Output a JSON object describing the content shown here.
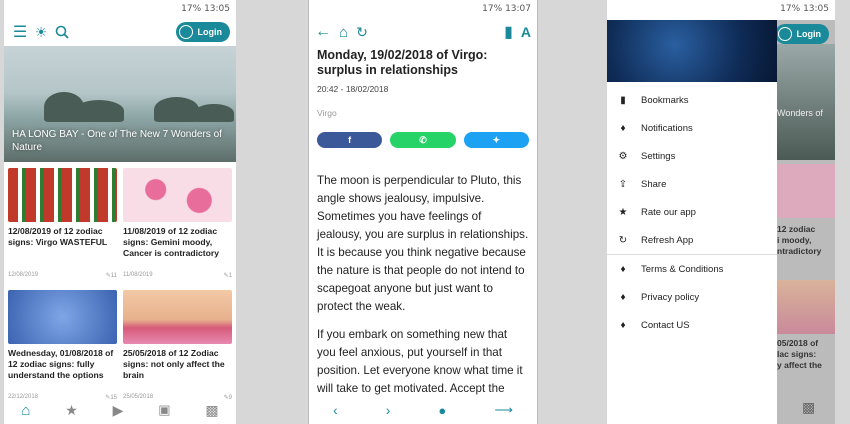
{
  "status": {
    "left_time": "13:05",
    "mid_time": "13:07",
    "right_time": "13:05",
    "battery": "17%"
  },
  "home": {
    "login": "Login",
    "hero_caption": "HA LONG BAY - One of The New 7 Wonders of Nature",
    "cards": [
      {
        "title": "12/08/2019 of 12 zodiac signs: Virgo WASTEFUL",
        "date": "12/08/2019",
        "count": "11",
        "color": "#c0392b"
      },
      {
        "title": "11/08/2019 of 12 zodiac signs: Gemini moody, Cancer is contradictory",
        "date": "11/08/2019",
        "count": "1",
        "color": "#f2b5c9"
      },
      {
        "title": "Wednesday, 01/08/2018 of 12 zodiac signs: fully understand the options",
        "date": "22/12/2018",
        "count": "15",
        "color": "#4f7fc9"
      },
      {
        "title": "25/05/2018 of 12 Zodiac signs: not only affect the brain",
        "date": "25/05/2018",
        "count": "9",
        "color": "#d9a27a"
      }
    ]
  },
  "article": {
    "title": "Monday, 19/02/2018 of Virgo: surplus in relationships",
    "time": "20:42 - 18/02/2018",
    "category": "Virgo",
    "para1": "The moon is perpendicular to Pluto, this angle shows jealousy, impulsive. Sometimes you have feelings of jealousy, you are surplus in relationships. It is because you think negative because the nature is that people do not intend to scapegoat anyone but just want to protect the weak.",
    "para2": "If you embark on something new that you feel anxious, put yourself in that position. Let everyone know what time it will take to get motivated. Accept the",
    "share_colors": {
      "facebook": "#3b5998",
      "whatsapp": "#25d366",
      "twitter": "#1da1f2"
    }
  },
  "drawer": {
    "login": "Login",
    "items": [
      {
        "label": "Bookmarks",
        "icon": "bookmark-icon"
      },
      {
        "label": "Notifications",
        "icon": "bell-icon"
      },
      {
        "label": "Settings",
        "icon": "gear-icon"
      },
      {
        "label": "Share",
        "icon": "share-icon"
      },
      {
        "label": "Rate our app",
        "icon": "star-icon"
      },
      {
        "label": "Refresh App",
        "icon": "refresh-icon"
      },
      {
        "label": "Terms & Conditions",
        "icon": "tag-icon"
      },
      {
        "label": "Privacy policy",
        "icon": "tag-icon"
      },
      {
        "label": "Contact US",
        "icon": "tag-icon"
      }
    ],
    "bg_snippets": [
      "Wonders of",
      "12 zodiac",
      "i moody,",
      "ntradictory",
      "1",
      "05/2018 of",
      "lac signs:",
      "y affect the"
    ]
  }
}
